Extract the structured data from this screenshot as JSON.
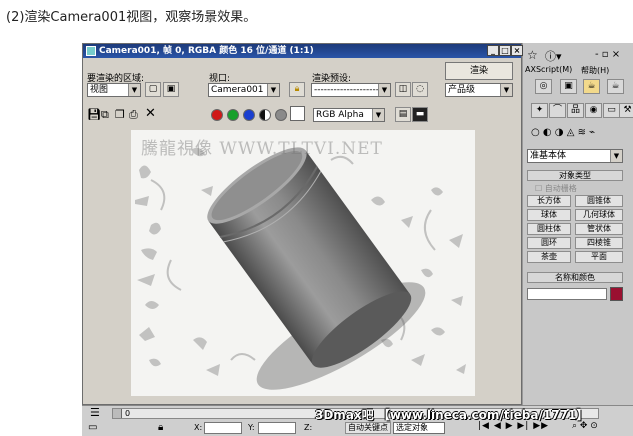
{
  "caption": "(2)渲染Camera001视图，观察场景效果。",
  "render_window": {
    "title": "Camera001, 帧 0, RGBA 颜色 16 位/通道 (1:1)",
    "area_label": "要渲染的区域:",
    "area_value": "视图",
    "viewport_label": "视口:",
    "viewport_value": "Camera001",
    "preset_label": "渲染预设:",
    "preset_value": "--------------------",
    "render_button": "渲染",
    "quality_value": "产品级",
    "channel_value": "RGB Alpha",
    "swatch_colors": [
      "#d01818",
      "#17a02c",
      "#1a3fd0",
      "#111111",
      "#8a8a8a"
    ],
    "watermark": "騰龍視像 WWW.TLTVI.NET"
  },
  "max_ui": {
    "menu_script": "AXScript(M)",
    "menu_help": "帮助(H)",
    "dropdown": "准基本体",
    "object_type_header": "对象类型",
    "auto_grid": "自动栅格",
    "primitives": [
      "长方体",
      "圆锥体",
      "球体",
      "几何球体",
      "圆柱体",
      "管状体",
      "圆环",
      "四棱锥",
      "茶壶",
      "平面"
    ],
    "name_color_header": "名称和颜色",
    "object_color": "#9a1030"
  },
  "status_bar": {
    "timeline_start": "0",
    "x_label": "X:",
    "y_label": "Y:",
    "z_label": "Z:",
    "auto_key": "自动关键点",
    "selected": "选定对象",
    "overlay_text": "3Dmax吧 【www.lineca.com/tieba/1771】"
  }
}
